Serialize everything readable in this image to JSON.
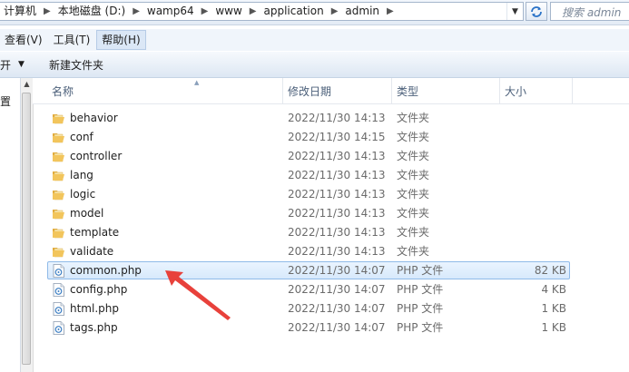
{
  "address": {
    "crumbs": [
      "计算机",
      "本地磁盘 (D:)",
      "wamp64",
      "www",
      "application",
      "admin"
    ]
  },
  "search": {
    "placeholder": "搜索 admin"
  },
  "menu": {
    "items": [
      {
        "label": "查看(V)",
        "active": false
      },
      {
        "label": "工具(T)",
        "active": false
      },
      {
        "label": "帮助(H)",
        "active": true
      }
    ]
  },
  "commands": {
    "partial": "开",
    "new_folder": "新建文件夹"
  },
  "nav": {
    "partial_text": "置"
  },
  "columns": {
    "name": "名称",
    "date": "修改日期",
    "type": "类型",
    "size": "大小"
  },
  "files": [
    {
      "name": "behavior",
      "date": "2022/11/30 14:13",
      "type": "文件夹",
      "size": "",
      "kind": "folder"
    },
    {
      "name": "conf",
      "date": "2022/11/30 14:15",
      "type": "文件夹",
      "size": "",
      "kind": "folder"
    },
    {
      "name": "controller",
      "date": "2022/11/30 14:13",
      "type": "文件夹",
      "size": "",
      "kind": "folder"
    },
    {
      "name": "lang",
      "date": "2022/11/30 14:13",
      "type": "文件夹",
      "size": "",
      "kind": "folder"
    },
    {
      "name": "logic",
      "date": "2022/11/30 14:13",
      "type": "文件夹",
      "size": "",
      "kind": "folder"
    },
    {
      "name": "model",
      "date": "2022/11/30 14:13",
      "type": "文件夹",
      "size": "",
      "kind": "folder"
    },
    {
      "name": "template",
      "date": "2022/11/30 14:13",
      "type": "文件夹",
      "size": "",
      "kind": "folder"
    },
    {
      "name": "validate",
      "date": "2022/11/30 14:13",
      "type": "文件夹",
      "size": "",
      "kind": "folder"
    },
    {
      "name": "common.php",
      "date": "2022/11/30 14:07",
      "type": "PHP 文件",
      "size": "82 KB",
      "kind": "php",
      "selected": true
    },
    {
      "name": "config.php",
      "date": "2022/11/30 14:07",
      "type": "PHP 文件",
      "size": "4 KB",
      "kind": "php"
    },
    {
      "name": "html.php",
      "date": "2022/11/30 14:07",
      "type": "PHP 文件",
      "size": "1 KB",
      "kind": "php"
    },
    {
      "name": "tags.php",
      "date": "2022/11/30 14:07",
      "type": "PHP 文件",
      "size": "1 KB",
      "kind": "php"
    }
  ],
  "colors": {
    "annotation_arrow": "#e8413b",
    "selection_border": "#8fbae8",
    "folder": "#f2c55c"
  }
}
